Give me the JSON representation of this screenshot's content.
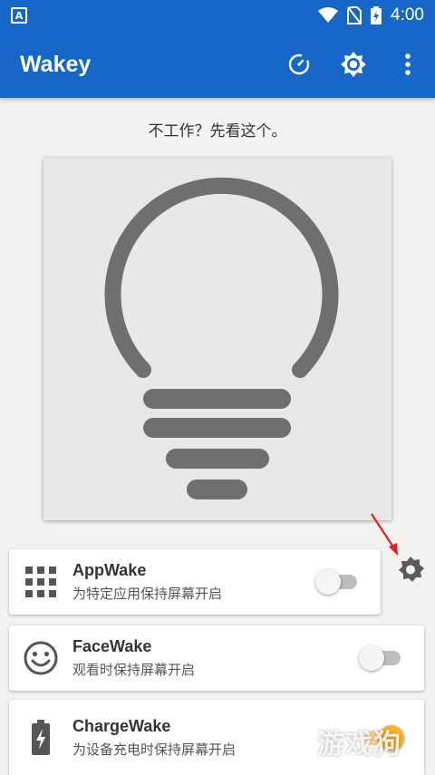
{
  "status_bar": {
    "app_icon_letter": "A",
    "time": "4:00",
    "icons": [
      "wifi-icon",
      "no-sim-icon",
      "battery-charging-icon"
    ]
  },
  "app_bar": {
    "title": "Wakey",
    "actions": [
      "timer-icon",
      "brightness-settings-icon",
      "more-vert-icon"
    ]
  },
  "notice": "不工作？先看这个。",
  "bulb_card": {
    "icon": "lightbulb-icon"
  },
  "rows": [
    {
      "title": "AppWake",
      "subtitle": "为特定应用保持屏幕开启",
      "icon": "apps-grid-icon",
      "enabled": false
    },
    {
      "title": "FaceWake",
      "subtitle": "观看时保持屏幕开启",
      "icon": "face-icon",
      "enabled": false
    },
    {
      "title": "ChargeWake",
      "subtitle": "为设备充电时保持屏幕开启",
      "icon": "battery-charging-icon",
      "enabled": true
    }
  ],
  "side_gear": {
    "icon": "settings-gear-icon"
  },
  "watermark": "游戏狗",
  "colors": {
    "primary": "#1667c7",
    "icon_gray": "#6f6f6f",
    "toggle_on": "#f6b42c",
    "arrow_red": "#e02020"
  }
}
